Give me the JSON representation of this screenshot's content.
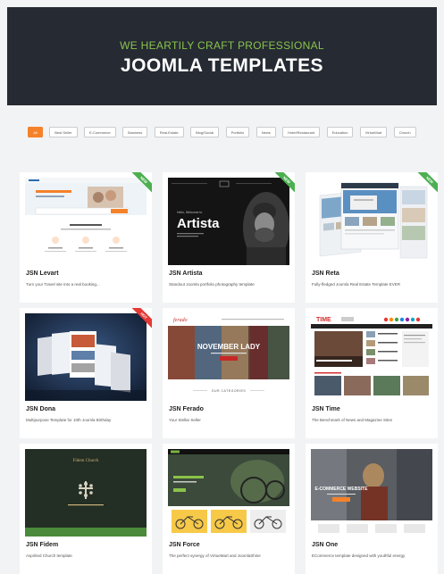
{
  "hero": {
    "subtitle": "WE HEARTILY CRAFT PROFESSIONAL",
    "title": "JOOMLA TEMPLATES"
  },
  "filters": [
    "All",
    "Best Seller",
    "E-Commerce",
    "Business",
    "Real-Estate",
    "Blog/Social",
    "Portfolio",
    "News",
    "Hotel/Restaurant",
    "Education",
    "VirtueMart",
    "Church"
  ],
  "active_filter": "All",
  "colors": {
    "accent": "#f5822a",
    "hero_bg": "#252a33",
    "hero_sub": "#8bc34a",
    "ribbon_new": "#4caf50",
    "ribbon_hot": "#e53935"
  },
  "templates": [
    {
      "title": "JSN Levart",
      "desc": "Turn your Travel site into a real booking...",
      "badge": "NEW"
    },
    {
      "title": "JSN Artista",
      "desc": "Standout Joomla portfolio photography template",
      "badge": "NEW",
      "thumb_text": {
        "hello": "Hello, Welcome to",
        "name": "Artista"
      }
    },
    {
      "title": "JSN Reta",
      "desc": "Fully-fledged Joomla Real Estate Template EVER",
      "badge": "NEW"
    },
    {
      "title": "JSN Dona",
      "desc": "Multipurpose Template for 10th Joomla Birthday",
      "badge": "HOT"
    },
    {
      "title": "JSN Ferado",
      "desc": "Your Stellar Seller",
      "badge": "",
      "thumb_text": {
        "logo": "ferado",
        "banner": "NOVEMBER LADY",
        "section": "OUR CATEGORIES"
      }
    },
    {
      "title": "JSN Time",
      "desc": "The Benchmark of News and Magazine Sites",
      "badge": "",
      "thumb_text": {
        "logo": "TIME"
      }
    },
    {
      "title": "JSN Fidem",
      "desc": "Aspirited Church template",
      "badge": "",
      "thumb_text": {
        "logo": "Fidem Church"
      }
    },
    {
      "title": "JSN Force",
      "desc": "The perfect synergy of VirtueMart and JoomlaShine",
      "badge": ""
    },
    {
      "title": "JSN One",
      "desc": "ECommerce template designed with youthful energy",
      "badge": "",
      "thumb_text": {
        "banner": "E-COMMERCE WEBSITE"
      }
    }
  ]
}
